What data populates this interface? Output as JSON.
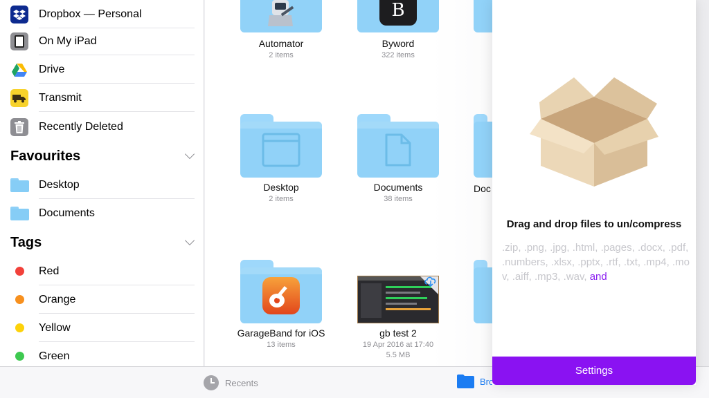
{
  "sidebar": {
    "locations": [
      {
        "label": "Dropbox — Personal",
        "icon": "dropbox-icon"
      },
      {
        "label": "On My iPad",
        "icon": "ipad-icon"
      },
      {
        "label": "Drive",
        "icon": "google-drive-icon"
      },
      {
        "label": "Transmit",
        "icon": "transmit-truck-icon"
      },
      {
        "label": "Recently Deleted",
        "icon": "trash-icon"
      }
    ],
    "favourites_title": "Favourites",
    "favourites": [
      {
        "label": "Desktop",
        "icon": "folder-icon"
      },
      {
        "label": "Documents",
        "icon": "folder-icon"
      }
    ],
    "tags_title": "Tags",
    "tags": [
      {
        "label": "Red",
        "color": "#f2413a"
      },
      {
        "label": "Orange",
        "color": "#f7901e"
      },
      {
        "label": "Yellow",
        "color": "#fdd20a"
      },
      {
        "label": "Green",
        "color": "#3ec950"
      }
    ]
  },
  "files": [
    {
      "name": "Automator",
      "meta": "2 items",
      "icon": "automator-robot-icon"
    },
    {
      "name": "Byword",
      "meta": "322 items",
      "icon": "byword-b-icon"
    },
    {
      "name": "Desktop",
      "meta": "2 items",
      "icon": "desktop-window-icon"
    },
    {
      "name": "Documents",
      "meta": "38 items",
      "icon": "document-icon"
    },
    {
      "name": "Doc",
      "meta": ""
    },
    {
      "name": "GarageBand for iOS",
      "meta": "13 items",
      "icon": "garageband-guitar-icon"
    },
    {
      "name": "gb test 2",
      "meta": "19 Apr 2016 at 17:40",
      "meta2": "5.5 MB",
      "icon": "cloud-download-icon"
    }
  ],
  "tabbar": {
    "recents_label": "Recents",
    "browse_label": "Browse"
  },
  "panel": {
    "heading": "Drag and drop files to un/compress",
    "formats": ".zip, .png, .jpg, .html, .pages, .docx, .pdf, .numbers, .xlsx, .pptx, .rtf, .txt, .mp4, .mov, .aiff, .mp3, .wav, ",
    "formats_and": "and",
    "settings_label": "Settings",
    "accent": "#8a12f2"
  }
}
